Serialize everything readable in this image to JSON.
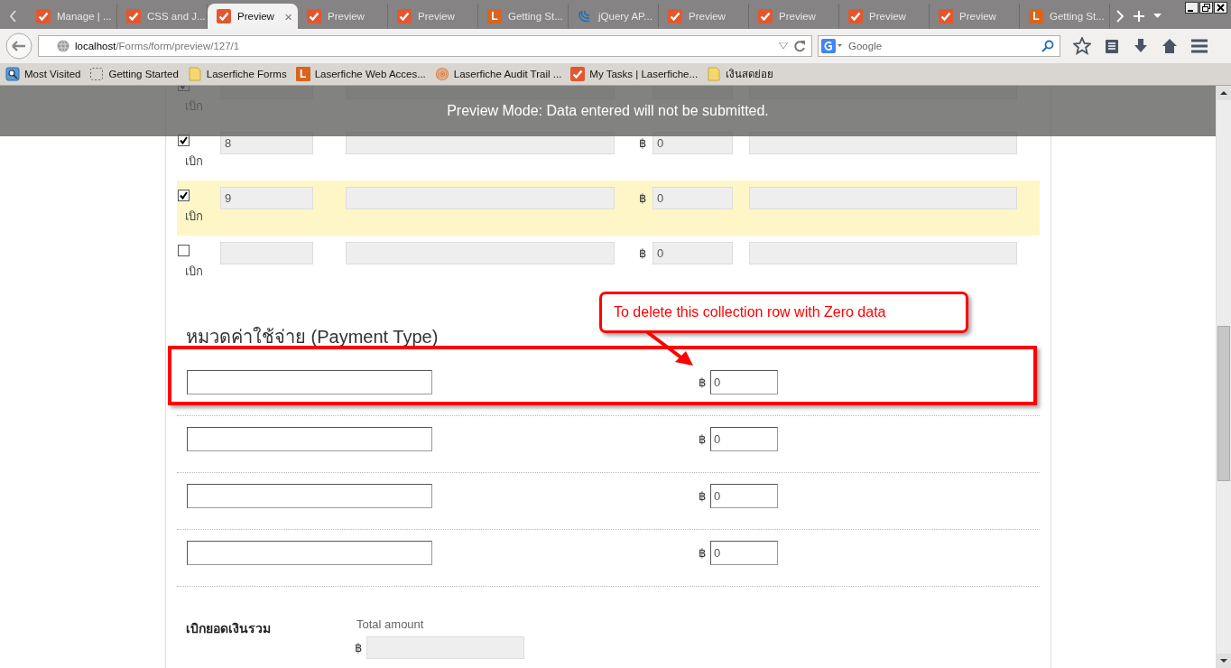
{
  "browser": {
    "tabs": [
      {
        "label": "Manage | ...",
        "kind": "check",
        "selected": false
      },
      {
        "label": "CSS and J...",
        "kind": "check",
        "selected": false
      },
      {
        "label": "Preview",
        "kind": "check",
        "selected": true,
        "close": "×"
      },
      {
        "label": "Preview",
        "kind": "check",
        "selected": false
      },
      {
        "label": "Preview",
        "kind": "check",
        "selected": false
      },
      {
        "label": "Getting St...",
        "kind": "letter",
        "icon_text": "L",
        "selected": false
      },
      {
        "label": "jQuery AP...",
        "kind": "jquery",
        "selected": false
      },
      {
        "label": "Preview",
        "kind": "check",
        "selected": false
      },
      {
        "label": "Preview",
        "kind": "check",
        "selected": false
      },
      {
        "label": "Preview",
        "kind": "check",
        "selected": false
      },
      {
        "label": "Preview",
        "kind": "check",
        "selected": false
      },
      {
        "label": "Getting St...",
        "kind": "letter",
        "icon_text": "L",
        "selected": false
      }
    ],
    "address": {
      "host": "localhost",
      "path": "/Forms/form/preview/127/1"
    },
    "search": {
      "placeholder": "Google"
    },
    "bookmarks": [
      {
        "label": "Most Visited",
        "kind": "most-visited"
      },
      {
        "label": "Getting Started",
        "kind": "dashed"
      },
      {
        "label": "Laserfiche Forms",
        "kind": "folder"
      },
      {
        "label": "Laserfiche Web Acces...",
        "kind": "letter",
        "icon_text": "L"
      },
      {
        "label": "Laserfiche Audit Trail ...",
        "kind": "fingerprint"
      },
      {
        "label": "My Tasks | Laserfiche...",
        "kind": "check"
      },
      {
        "label": "เงินสดย่อย",
        "kind": "folder"
      }
    ]
  },
  "banner": "Preview Mode: Data entered will not be submitted.",
  "collection": {
    "rows": [
      {
        "checked": true,
        "check_label": "เบิก",
        "highlighted": false
      },
      {
        "checked": true,
        "check_label": "เบิก",
        "number": "8",
        "currency": "฿",
        "amount": "0",
        "highlighted": false
      },
      {
        "checked": true,
        "check_label": "เบิก",
        "number": "9",
        "currency": "฿",
        "amount": "0",
        "highlighted": true
      },
      {
        "checked": false,
        "check_label": "เบิก",
        "currency": "฿",
        "amount": "0",
        "highlighted": false
      }
    ]
  },
  "payment": {
    "title": "หมวดค่าใช้จ่าย (Payment Type)",
    "rows": [
      {
        "currency": "฿",
        "amount": "0"
      },
      {
        "currency": "฿",
        "amount": "0"
      },
      {
        "currency": "฿",
        "amount": "0"
      },
      {
        "currency": "฿",
        "amount": "0"
      }
    ]
  },
  "total": {
    "label": "เบิกยอดเงินรวม",
    "sublabel": "Total amount",
    "currency": "฿"
  },
  "annotation": {
    "text": "To delete this collection row with Zero data"
  }
}
